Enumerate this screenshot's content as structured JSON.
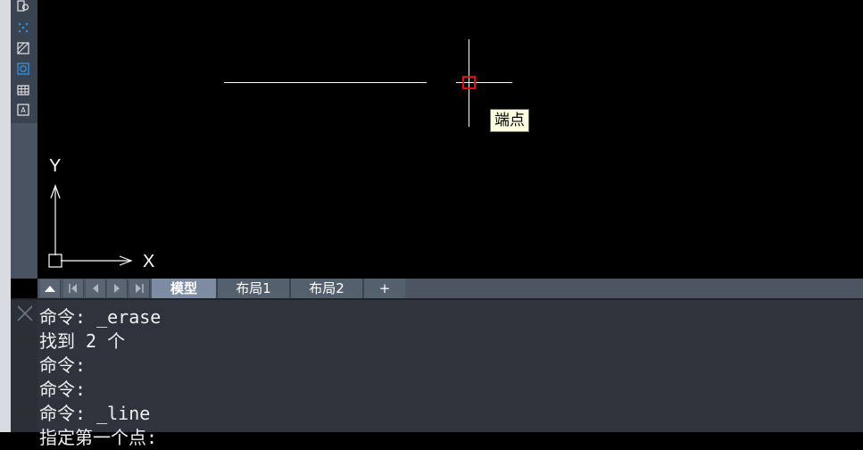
{
  "tooltip": {
    "text": "端点"
  },
  "ucs": {
    "x_label": "X",
    "y_label": "Y"
  },
  "layout_tabs": [
    {
      "label": "模型",
      "active": true
    },
    {
      "label": "布局1",
      "active": false
    },
    {
      "label": "布局2",
      "active": false
    },
    {
      "label": "+",
      "active": false
    }
  ],
  "command_history": [
    "命令: _erase",
    "找到 2 个",
    "命令:",
    "命令:",
    "命令: _line",
    "指定第一个点:"
  ],
  "colors": {
    "canvas": "#000000",
    "snap_marker": "#e01010",
    "tooltip_bg": "#ffffe1",
    "active_tab": "#7d8ca3",
    "command_bg": "#2f343c",
    "toolbar_icon": "#2f8fe0"
  },
  "toolbar": {
    "icons": [
      "properties-icon",
      "point-icon",
      "hatch-icon",
      "region-icon",
      "table-icon",
      "text-box-icon"
    ]
  },
  "tab_nav": {
    "icons": [
      "scroll-up-icon",
      "first-tab-icon",
      "prev-tab-icon",
      "next-tab-icon",
      "last-tab-icon"
    ]
  }
}
